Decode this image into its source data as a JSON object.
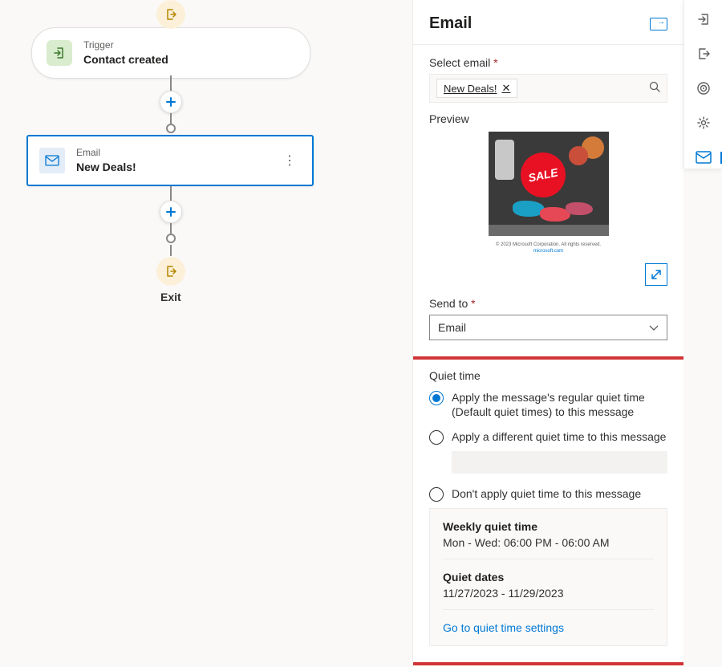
{
  "canvas": {
    "trigger": {
      "label": "Trigger",
      "title": "Contact created"
    },
    "email_node": {
      "label": "Email",
      "title": "New Deals!"
    },
    "exit_label": "Exit"
  },
  "panel": {
    "title": "Email",
    "select_email_label": "Select email",
    "selected_email_chip": "New Deals!",
    "preview_label": "Preview",
    "preview_sale_text": "SALE",
    "preview_caption_line1": "© 2023 Microsoft Corporation. All rights reserved.",
    "preview_caption_line2": "microsoft.com",
    "send_to_label": "Send to",
    "send_to_value": "Email"
  },
  "quiet": {
    "section_label": "Quiet time",
    "option1": "Apply the message's regular quiet time (Default quiet times) to this message",
    "option2": "Apply a different quiet time to this message",
    "option3": "Don't apply quiet time to this message",
    "weekly_title": "Weekly quiet time",
    "weekly_value": "Mon - Wed: 06:00 PM - 06:00 AM",
    "dates_title": "Quiet dates",
    "dates_value": "11/27/2023 - 11/29/2023",
    "link": "Go to quiet time settings"
  },
  "rail": {
    "items": [
      "enter-icon",
      "exit-icon",
      "target-icon",
      "gear-icon",
      "mail-icon"
    ]
  }
}
